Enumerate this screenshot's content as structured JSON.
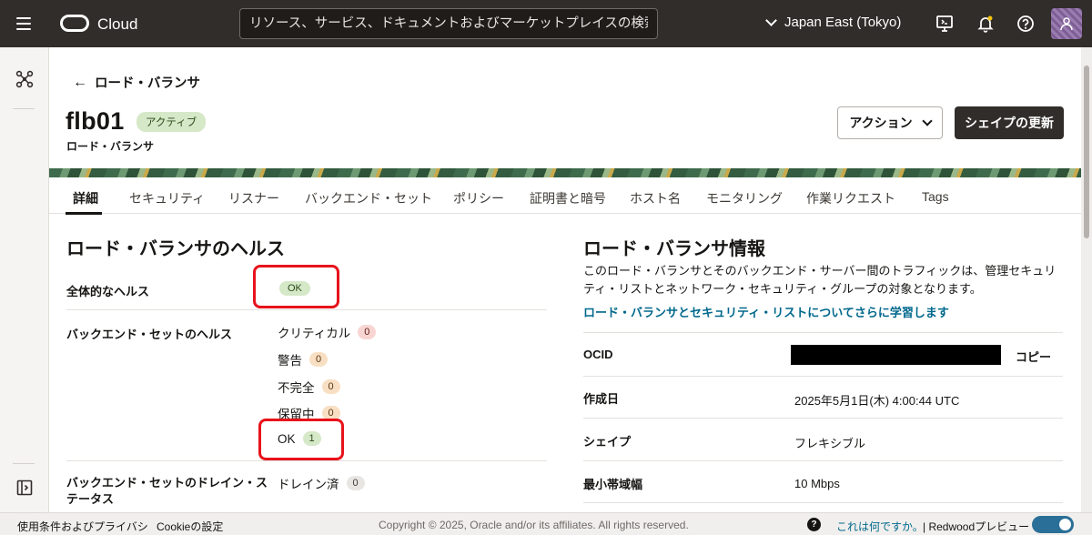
{
  "topbar": {
    "brand": "Cloud",
    "search_placeholder": "リソース、サービス、ドキュメントおよびマーケットプレイスの検索",
    "region": "Japan East (Tokyo)"
  },
  "page": {
    "back_label": "ロード・バランサ",
    "title": "flb01",
    "status": "アクティブ",
    "subtitle": "ロード・バランサ",
    "action_button": "アクション",
    "primary_button": "シェイプの更新"
  },
  "tabs": [
    "詳細",
    "セキュリティ",
    "リスナー",
    "バックエンド・セット",
    "ポリシー",
    "証明書と暗号",
    "ホスト名",
    "モニタリング",
    "作業リクエスト",
    "Tags"
  ],
  "health": {
    "heading": "ロード・バランサのヘルス",
    "overall_label": "全体的なヘルス",
    "overall_value": "OK",
    "backend_label": "バックエンド・セットのヘルス",
    "backend_stats": [
      {
        "label": "クリティカル",
        "count": "0"
      },
      {
        "label": "警告",
        "count": "0"
      },
      {
        "label": "不完全",
        "count": "0"
      },
      {
        "label": "保留中",
        "count": "0"
      },
      {
        "label": "OK",
        "count": "1"
      }
    ],
    "drain_label": "バックエンド・セットのドレイン・ステータス",
    "drain_value": "ドレイン済",
    "drain_count": "0"
  },
  "info": {
    "heading": "ロード・バランサ情報",
    "description": "このロード・バランサとそのバックエンド・サーバー間のトラフィックは、管理セキュリティ・リストとネットワーク・セキュリティ・グループの対象となります。",
    "link": "ロード・バランサとセキュリティ・リストについてさらに学習します",
    "rows": [
      {
        "label": "OCID",
        "value": ""
      },
      {
        "label": "作成日",
        "value": "2025年5月1日(木) 4:00:44 UTC"
      },
      {
        "label": "シェイプ",
        "value": "フレキシブル"
      },
      {
        "label": "最小帯域幅",
        "value": "10 Mbps"
      }
    ],
    "copy_label": "コピー"
  },
  "footer": {
    "terms": "使用条件およびプライバシ",
    "cookie": "Cookieの設定",
    "copyright": "Copyright © 2025, Oracle and/or its affiliates. All rights reserved.",
    "whats_this": "これは何ですか。",
    "redwood": "| Redwoodプレビュー"
  }
}
